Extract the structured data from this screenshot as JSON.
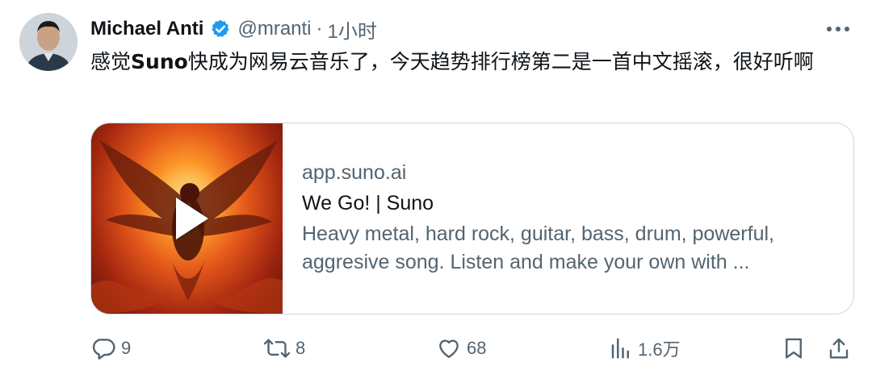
{
  "tweet": {
    "author_name": "Michael Anti",
    "handle": "@mranti",
    "separator": "·",
    "time": "1小时",
    "text_part1": "感觉",
    "text_bold": "Suno",
    "text_part2": "快成为网易云音乐了，今天趋势排行榜第二是一首中文摇滚，很好听啊"
  },
  "card": {
    "domain": "app.suno.ai",
    "title": "We Go! | Suno",
    "description": "Heavy metal, hard rock, guitar, bass, drum, powerful, aggresive song. Listen and make your own with ..."
  },
  "actions": {
    "replies": "9",
    "reposts": "8",
    "likes": "68",
    "views": "1.6万"
  },
  "colors": {
    "verified": "#1d9bf0",
    "secondary_text": "#536471",
    "border": "#cfd9de"
  }
}
